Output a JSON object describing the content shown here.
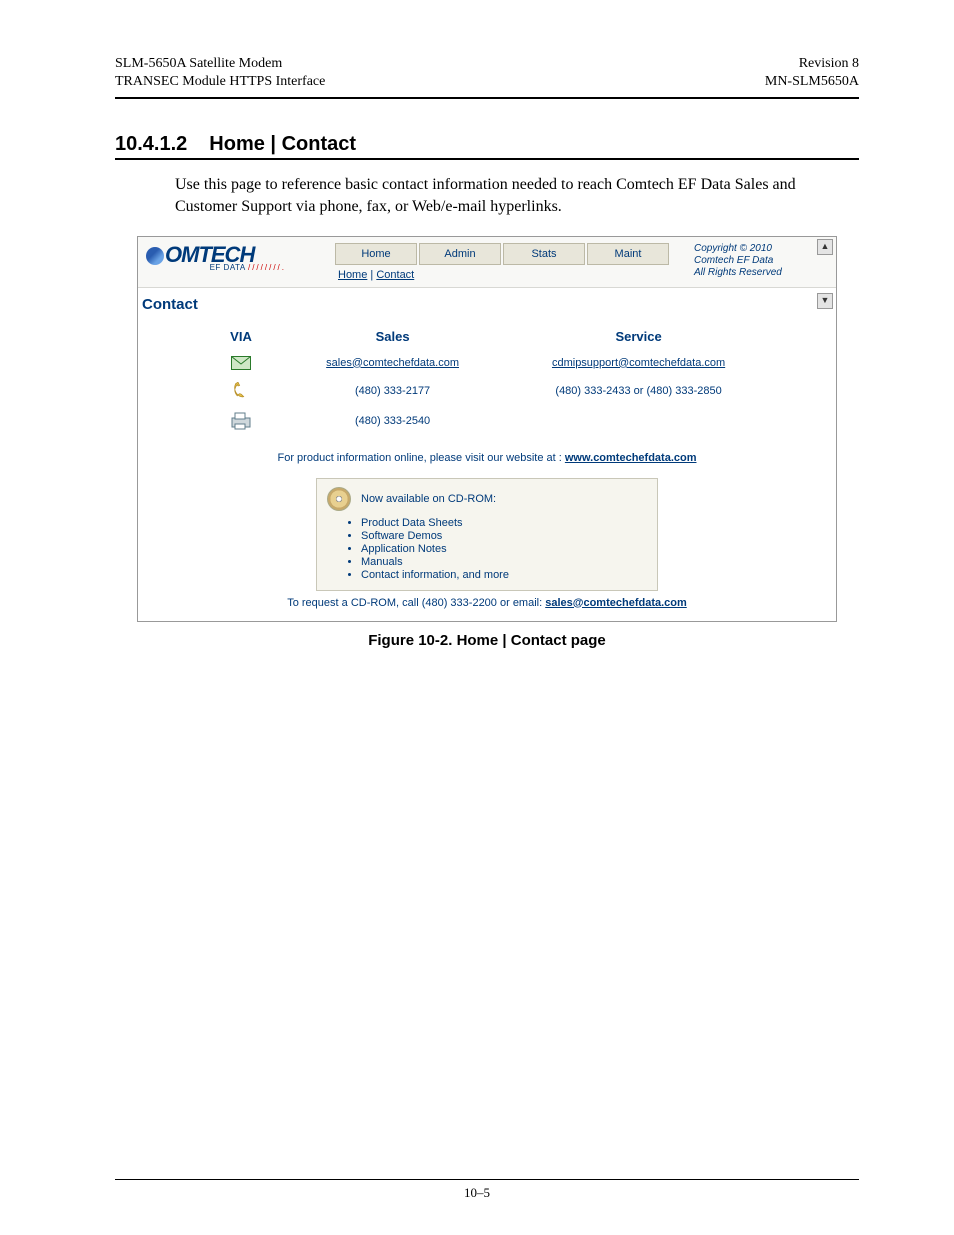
{
  "header": {
    "left": "SLM-5650A Satellite Modem\nTRANSEC Module HTTPS Interface",
    "right": "Revision 8\nMN-SLM5650A"
  },
  "section": {
    "number": "10.4.1.2",
    "title": "Home | Contact",
    "body": "Use this page to reference basic contact information needed to reach Comtech EF Data Sales and Customer Support via phone, fax, or Web/e-mail hyperlinks."
  },
  "screenshot": {
    "logo": {
      "main": "OMTECH",
      "sub_blue": "EF DATA",
      "sub_red": "////////."
    },
    "nav": [
      "Home",
      "Admin",
      "Stats",
      "Maint"
    ],
    "breadcrumb": {
      "home": "Home",
      "contact": "Contact"
    },
    "copyright": "Copyright © 2010\nComtech EF Data\nAll Rights Reserved",
    "page_title": "Contact",
    "table": {
      "headers": {
        "via": "VIA",
        "sales": "Sales",
        "service": "Service"
      },
      "rows": {
        "email": {
          "sales": "sales@comtechefdata.com",
          "service": "cdmipsupport@comtechefdata.com"
        },
        "phone": {
          "sales": "(480) 333-2177",
          "service": "(480) 333-2433 or (480) 333-2850"
        },
        "fax": {
          "sales": "(480) 333-2540",
          "service": ""
        }
      }
    },
    "website": {
      "prefix": "For product information online, please visit our website at : ",
      "link": "www.comtechefdata.com"
    },
    "cdrom": {
      "heading": "Now available on CD-ROM:",
      "items": [
        "Product Data Sheets",
        "Software Demos",
        "Application Notes",
        "Manuals",
        "Contact information, and more"
      ],
      "request_prefix": "To request a CD-ROM, call (480) 333-2200 or email:  ",
      "request_link": "sales@comtechefdata.com"
    }
  },
  "figure_caption": "Figure 10-2. Home | Contact page",
  "footer_page": "10–5"
}
